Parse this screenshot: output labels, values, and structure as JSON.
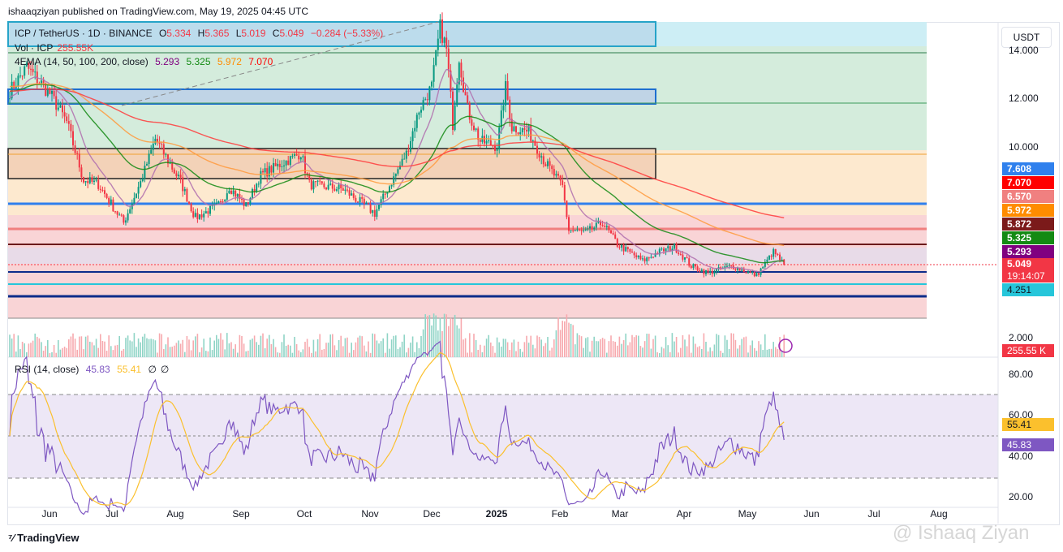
{
  "publisher": "ishaaqziyan published on TradingView.com, May 19, 2025 04:45 UTC",
  "symbol": {
    "title": "ICP / TetherUS · 1D · BINANCE",
    "o_label": "O",
    "o": "5.334",
    "h_label": "H",
    "h": "5.365",
    "l_label": "L",
    "l": "5.019",
    "c_label": "C",
    "c": "5.049",
    "change": "−0.284 (−5.33%)"
  },
  "volume": {
    "label": "Vol · ICP",
    "value": "255.55K"
  },
  "ema": {
    "label": "4EMA (14, 50, 100, 200, close)",
    "v14": "5.293",
    "v50": "5.325",
    "v100": "5.972",
    "v200": "7.070"
  },
  "rsi": {
    "label": "RSI (14, close)",
    "value": "45.83",
    "ma": "55.41",
    "n1": "∅",
    "n2": "∅"
  },
  "currency": "USDT",
  "price_axis": [
    "14.000",
    "12.000",
    "10.000",
    "2.000"
  ],
  "rsi_axis": [
    "80.00",
    "60.00",
    "40.00",
    "20.00"
  ],
  "price_tags": [
    {
      "text": "7.608",
      "color": "#2f80ed"
    },
    {
      "text": "7.070",
      "color": "#ff0000"
    },
    {
      "text": "6.570",
      "color": "#f08080"
    },
    {
      "text": "5.972",
      "color": "#ff8c00"
    },
    {
      "text": "5.872",
      "color": "#7b1a1a"
    },
    {
      "text": "5.325",
      "color": "#138a13"
    },
    {
      "text": "5.293",
      "color": "#800080"
    }
  ],
  "last_price": {
    "text": "5.049",
    "countdown": "19:14:07",
    "color": "#f23645"
  },
  "level_4251": {
    "text": "4.251",
    "color": "#26c6da"
  },
  "vol_tag": "255.55 K",
  "rsi_tags": {
    "ma": "55.41",
    "rsi": "45.83"
  },
  "time_axis": [
    "Jun",
    "Jul",
    "Aug",
    "Sep",
    "Oct",
    "Nov",
    "Dec",
    "2025",
    "Feb",
    "Mar",
    "Apr",
    "May",
    "Jun",
    "Jul",
    "Aug"
  ],
  "footer": "TradingView",
  "watermark": "@ Ishaaq Ziyan",
  "chart_data": {
    "type": "candlestick",
    "title": "ICP / TetherUS · 1D · BINANCE",
    "ylim": [
      2,
      14.6
    ],
    "close_keypoints": [
      [
        0,
        12.3
      ],
      [
        8,
        13.3
      ],
      [
        19,
        12.2
      ],
      [
        27,
        11.0
      ],
      [
        35,
        8.6
      ],
      [
        42,
        8.4
      ],
      [
        54,
        6.8
      ],
      [
        62,
        8.5
      ],
      [
        69,
        10.3
      ],
      [
        81,
        8.5
      ],
      [
        88,
        7.0
      ],
      [
        100,
        7.6
      ],
      [
        104,
        8.3
      ],
      [
        112,
        7.5
      ],
      [
        119,
        8.8
      ],
      [
        138,
        9.7
      ],
      [
        142,
        8.4
      ],
      [
        158,
        8.2
      ],
      [
        173,
        7.2
      ],
      [
        181,
        8.5
      ],
      [
        188,
        9.7
      ],
      [
        194,
        11.5
      ],
      [
        200,
        12.5
      ],
      [
        204,
        15.0
      ],
      [
        207,
        14.0
      ],
      [
        210,
        11.0
      ],
      [
        213,
        13.7
      ],
      [
        217,
        11.5
      ],
      [
        223,
        10.2
      ],
      [
        231,
        10.0
      ],
      [
        235,
        12.5
      ],
      [
        238,
        10.8
      ],
      [
        246,
        10.6
      ],
      [
        254,
        9.3
      ],
      [
        262,
        8.3
      ],
      [
        265,
        6.5
      ],
      [
        273,
        6.4
      ],
      [
        281,
        6.8
      ],
      [
        288,
        5.9
      ],
      [
        300,
        5.2
      ],
      [
        308,
        5.6
      ],
      [
        315,
        5.8
      ],
      [
        323,
        5.0
      ],
      [
        331,
        4.7
      ],
      [
        342,
        5.0
      ],
      [
        354,
        4.6
      ],
      [
        362,
        5.6
      ],
      [
        367,
        5.049
      ]
    ]
  }
}
